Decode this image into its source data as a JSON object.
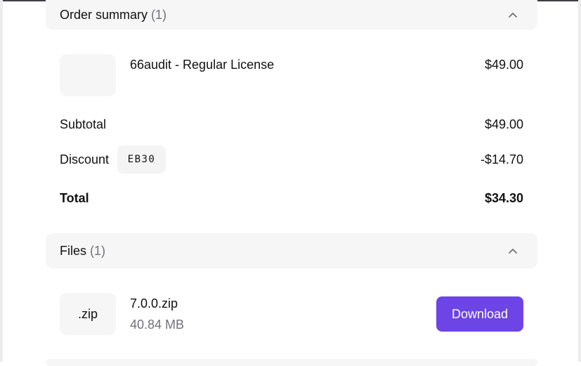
{
  "order_summary": {
    "title": "Order summary",
    "count": "(1)",
    "item": {
      "name": "66audit - Regular License",
      "price": "$49.00"
    },
    "subtotal": {
      "label": "Subtotal",
      "value": "$49.00"
    },
    "discount": {
      "label": "Discount",
      "code": "EB30",
      "value": "-$14.70"
    },
    "total": {
      "label": "Total",
      "value": "$34.30"
    }
  },
  "files": {
    "title": "Files",
    "count": "(1)",
    "items": [
      {
        "type_label": ".zip",
        "name": "7.0.0.zip",
        "size": "40.84 MB",
        "download_label": "Download"
      }
    ]
  },
  "colors": {
    "accent": "#6d44e6",
    "panel_bg": "#f6f6f6",
    "muted_text": "#71717a"
  },
  "icons": {
    "collapse": "chevron-up-icon"
  }
}
